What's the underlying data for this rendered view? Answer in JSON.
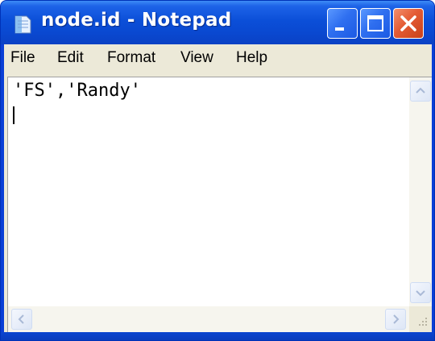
{
  "window": {
    "title": "node.id - Notepad",
    "accent_color": "#0a48d0",
    "close_color": "#e45b34"
  },
  "menu": {
    "items": [
      "File",
      "Edit",
      "Format",
      "View",
      "Help"
    ]
  },
  "editor": {
    "content": "'FS','Randy'"
  },
  "icons": {
    "app": "notepad-icon",
    "minimize": "minimize-icon",
    "maximize": "maximize-icon",
    "close": "close-icon",
    "scroll_up": "chevron-up-icon",
    "scroll_down": "chevron-down-icon",
    "scroll_left": "chevron-left-icon",
    "scroll_right": "chevron-right-icon",
    "resize_grip": "resize-grip-icon"
  }
}
